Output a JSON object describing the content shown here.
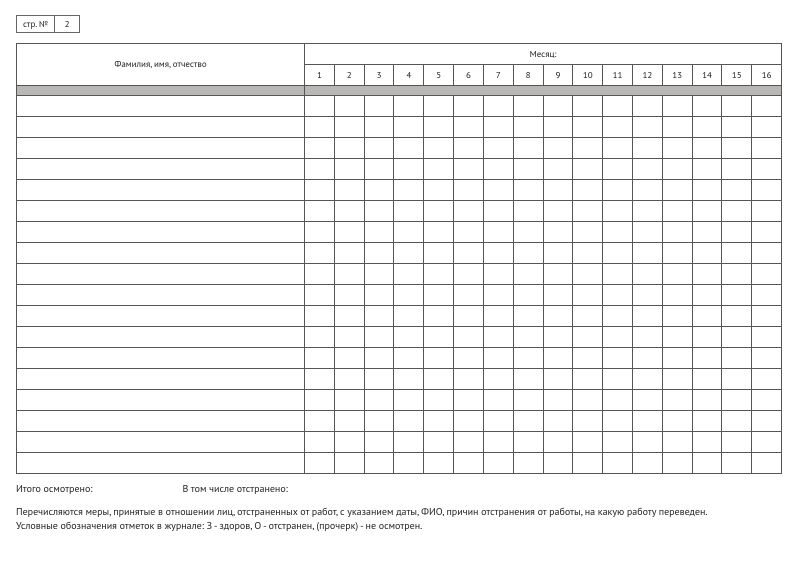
{
  "page_num": {
    "label": "стр. №",
    "value": "2"
  },
  "table": {
    "name_header": "Фамилия, имя, отчество",
    "month_label": "Месяц:",
    "days": [
      "1",
      "2",
      "3",
      "4",
      "5",
      "6",
      "7",
      "8",
      "9",
      "10",
      "11",
      "12",
      "13",
      "14",
      "15",
      "16"
    ],
    "row_count": 18
  },
  "totals": {
    "inspected": "Итого осмотрено:",
    "suspended": "В том числе отстранено:"
  },
  "footnote": {
    "line1": "Перечисляются меры, принятые в отношении лиц, отстраненных от работ, с указанием даты, ФИО, причин отстранения от работы, на какую работу переведен.",
    "line2": "Условные обозначения отметок в журнале: З - здоров, О - отстранен, (прочерк) - не осмотрен."
  }
}
